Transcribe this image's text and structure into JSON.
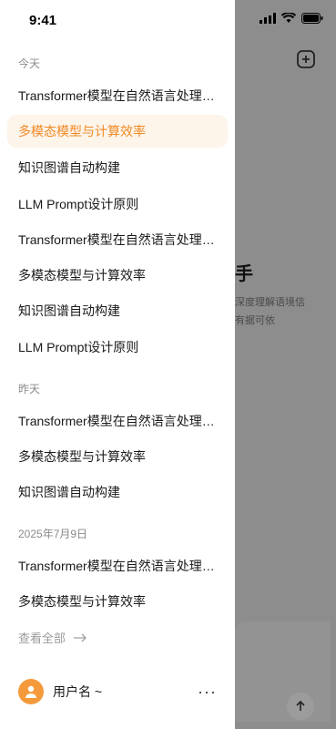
{
  "status_bar": {
    "time": "9:41"
  },
  "background": {
    "hero_char": "手",
    "sub_line1": "深度理解语境信",
    "sub_line2": "有据可依"
  },
  "drawer": {
    "sections": [
      {
        "label": "今天",
        "items": [
          {
            "label": "Transformer模型在自然语言处理中的应用"
          },
          {
            "label": "多模态模型与计算效率",
            "active": true
          },
          {
            "label": "知识图谱自动构建"
          },
          {
            "label": "LLM Prompt设计原则"
          },
          {
            "label": "Transformer模型在自然语言处理中的应用"
          },
          {
            "label": "多模态模型与计算效率"
          },
          {
            "label": "知识图谱自动构建"
          },
          {
            "label": "LLM Prompt设计原则"
          }
        ]
      },
      {
        "label": "昨天",
        "items": [
          {
            "label": "Transformer模型在自然语言处理中的应用"
          },
          {
            "label": "多模态模型与计算效率"
          },
          {
            "label": "知识图谱自动构建"
          }
        ]
      },
      {
        "label": "2025年7月9日",
        "items": [
          {
            "label": "Transformer模型在自然语言处理中的应用"
          },
          {
            "label": "多模态模型与计算效率"
          }
        ]
      }
    ],
    "view_all": "查看全部",
    "user_name": "用户名 ~",
    "more": "···"
  },
  "colors": {
    "accent": "#f08a24",
    "active_bg": "#fdf4ea",
    "avatar": "#f59a3c"
  }
}
